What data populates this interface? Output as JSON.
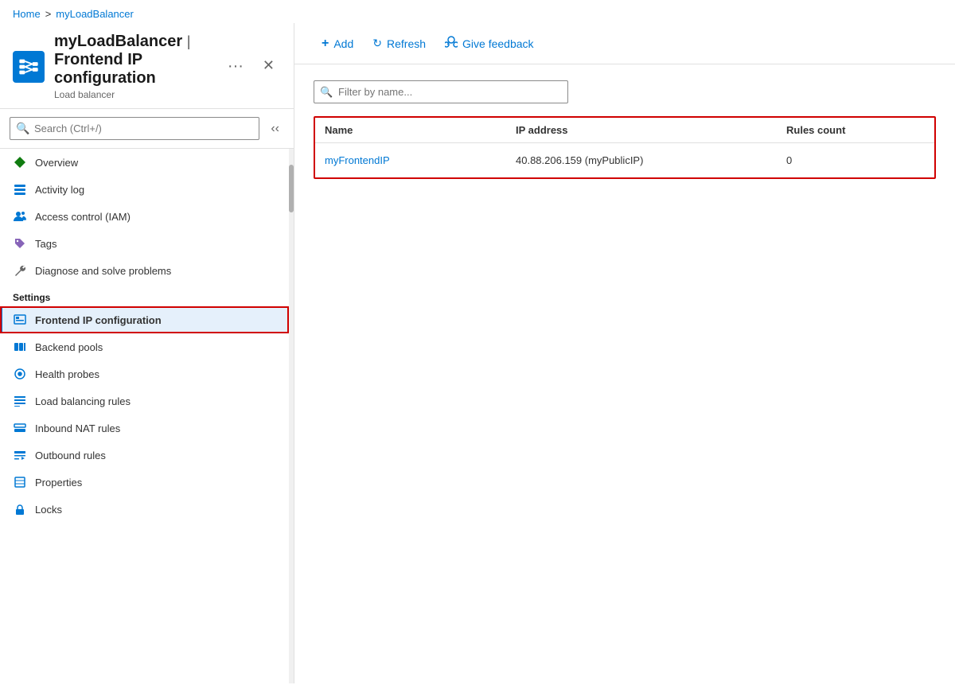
{
  "breadcrumb": {
    "home": "Home",
    "separator": ">",
    "current": "myLoadBalancer"
  },
  "resource": {
    "name": "myLoadBalancer",
    "page_title": "Frontend IP configuration",
    "subtitle": "Load balancer"
  },
  "header": {
    "dots_label": "···",
    "close_label": "✕"
  },
  "search": {
    "placeholder": "Search (Ctrl+/)"
  },
  "toolbar": {
    "add_label": "Add",
    "refresh_label": "Refresh",
    "feedback_label": "Give feedback"
  },
  "filter": {
    "placeholder": "Filter by name..."
  },
  "table": {
    "columns": [
      "Name",
      "IP address",
      "Rules count"
    ],
    "rows": [
      {
        "name": "myFrontendIP",
        "ip_address": "40.88.206.159 (myPublicIP)",
        "rules_count": "0"
      }
    ]
  },
  "nav": {
    "items": [
      {
        "id": "overview",
        "label": "Overview",
        "icon": "diamond"
      },
      {
        "id": "activity-log",
        "label": "Activity log",
        "icon": "list"
      },
      {
        "id": "access-control",
        "label": "Access control (IAM)",
        "icon": "people"
      },
      {
        "id": "tags",
        "label": "Tags",
        "icon": "tag"
      },
      {
        "id": "diagnose",
        "label": "Diagnose and solve problems",
        "icon": "wrench"
      }
    ],
    "settings_label": "Settings",
    "settings_items": [
      {
        "id": "frontend-ip",
        "label": "Frontend IP configuration",
        "icon": "grid",
        "active": true
      },
      {
        "id": "backend-pools",
        "label": "Backend pools",
        "icon": "backend"
      },
      {
        "id": "health-probes",
        "label": "Health probes",
        "icon": "probe"
      },
      {
        "id": "lb-rules",
        "label": "Load balancing rules",
        "icon": "lb"
      },
      {
        "id": "nat-rules",
        "label": "Inbound NAT rules",
        "icon": "nat"
      },
      {
        "id": "outbound-rules",
        "label": "Outbound rules",
        "icon": "outbound"
      },
      {
        "id": "properties",
        "label": "Properties",
        "icon": "props"
      },
      {
        "id": "locks",
        "label": "Locks",
        "icon": "lock"
      }
    ]
  }
}
